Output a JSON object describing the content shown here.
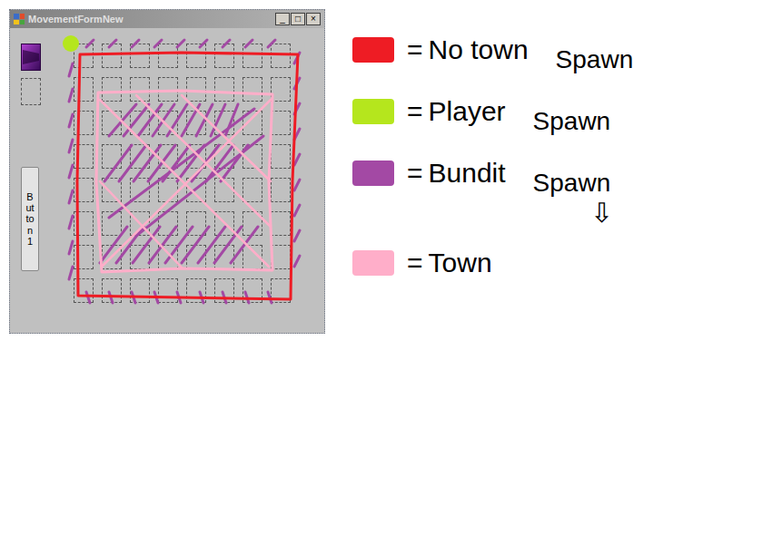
{
  "window": {
    "title": "MovementFormNew",
    "controls": [
      "_",
      "□",
      "×"
    ]
  },
  "button": {
    "label": "Button1"
  },
  "grid": {
    "rows": 8,
    "columns": 8
  },
  "legend": [
    {
      "sign": "=",
      "label": "No town",
      "extra": "Spawn",
      "color": "#ee1c24"
    },
    {
      "sign": "=",
      "label": "Player",
      "extra": "Spawn",
      "color": "#b5e61d"
    },
    {
      "sign": "=",
      "label": "Bundit",
      "extra": "Spawn",
      "color": "#a349a4"
    },
    {
      "sign": "=",
      "label": "Town",
      "extra": "",
      "color": "#ffaec9"
    }
  ],
  "note": "⇩"
}
